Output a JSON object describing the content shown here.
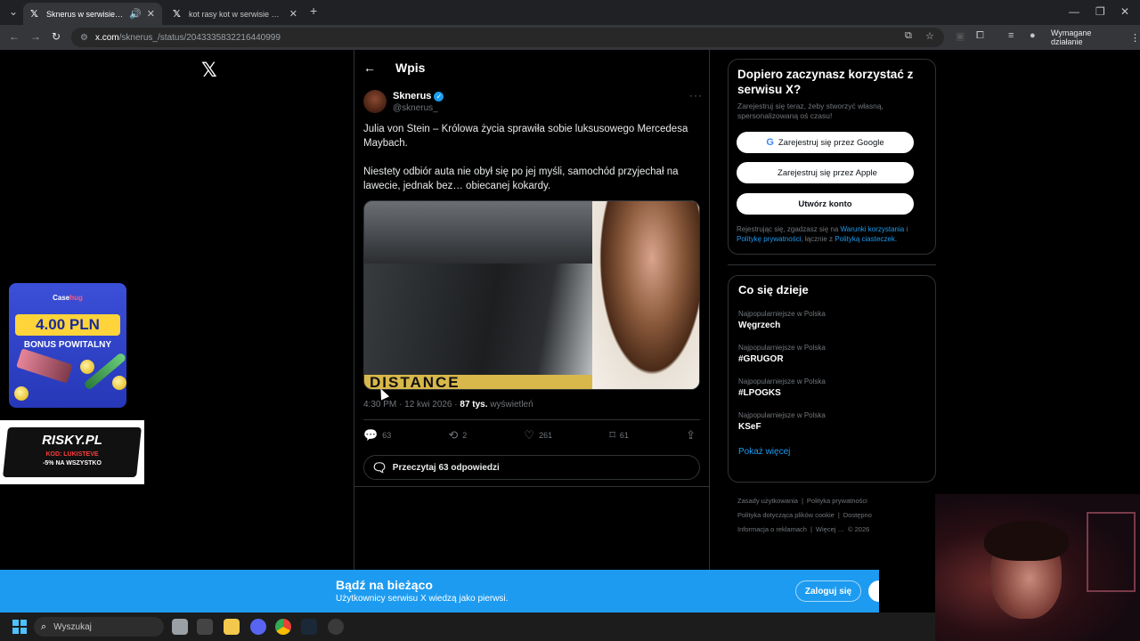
{
  "browser": {
    "tabs": [
      {
        "title": "Sknerus w serwisie X: „Juli",
        "active": true
      },
      {
        "title": "kot rasy kot w serwisie X: „wysł",
        "active": false
      }
    ],
    "url_host": "x.com",
    "url_path": "/sknerus_/status/2043335832216440999",
    "action_required": "Wymagane działanie"
  },
  "post": {
    "header": "Wpis",
    "author_name": "Sknerus",
    "author_handle": "@sknerus_",
    "text_p1": "Julia von Stein – Królowa życia sprawiła sobie luksusowego Mercedesa Maybach.",
    "text_p2": "Niestety odbiór auta nie obył się po jej myśli, samochód przyjechał na lawecie, jednak bez… obiecanej kokardy.",
    "image_text": "DISTANCE",
    "time": "4:30 PM · 12 kwi 2026 ·",
    "views_count": "87 tys.",
    "views_label": "wyświetleń",
    "replies": "63",
    "reposts": "2",
    "likes": "261",
    "bookmarks": "61",
    "read_replies": "Przeczytaj 63 odpowiedzi"
  },
  "signup": {
    "title": "Dopiero zaczynasz korzystać z serwisu X?",
    "subtitle": "Zarejestruj się teraz, żeby stworzyć własną, spersonalizowaną oś czasu!",
    "google": "Zarejestruj się przez Google",
    "apple": "Zarejestruj się przez Apple",
    "create": "Utwórz konto",
    "legal_pre": "Rejestrując się, zgadzasz się na ",
    "legal_terms": "Warunki korzystania",
    "legal_mid": " i ",
    "legal_privacy": "Politykę prywatności",
    "legal_mid2": ", łącznie z ",
    "legal_cookies": "Polityką ciasteczek",
    "legal_end": "."
  },
  "trends": {
    "title": "Co się dzieje",
    "items": [
      {
        "context": "Najpopularniejsze w Polska",
        "name": "Węgrzech"
      },
      {
        "context": "Najpopularniejsze w Polska",
        "name": "#GRUGOR"
      },
      {
        "context": "Najpopularniejsze w Polska",
        "name": "#LPOGKS"
      },
      {
        "context": "Najpopularniejsze w Polska",
        "name": "KSeF"
      }
    ],
    "show_more": "Pokaż więcej"
  },
  "footer": {
    "links": [
      "Zasady użytkowania",
      "|",
      "Polityka prywatności",
      "Polityka dotycząca plików cookie",
      "|",
      "Dostępno",
      "Informacja o reklamach",
      "|",
      "Więcej …",
      "© 2026"
    ]
  },
  "ads": {
    "casehug_brand_a": "Case",
    "casehug_brand_b": "hug",
    "casehug_amount": "4.00 PLN",
    "casehug_bonus": "BONUS POWITALNY",
    "risky_logo": "RISKY.PL",
    "risky_code": "KOD: LUKISTEVE",
    "risky_discount": "-5% NA WSZYSTKO"
  },
  "banner": {
    "title": "Bądź na bieżąco",
    "subtitle": "Użytkownicy serwisu X wiedzą jako pierwsi.",
    "login": "Zaloguj się"
  },
  "taskbar": {
    "search_placeholder": "Wyszukaj"
  },
  "colors": {
    "accent": "#1d9bf0",
    "background": "#000000",
    "border": "#2f3336"
  }
}
